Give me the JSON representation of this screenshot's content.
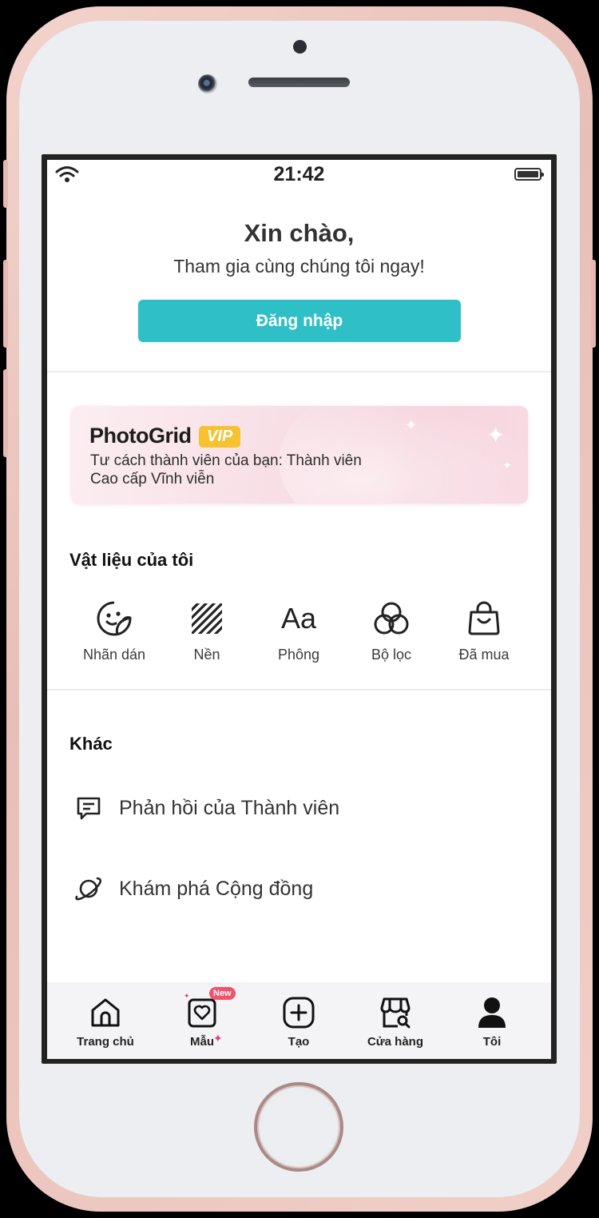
{
  "status_bar": {
    "time": "21:42"
  },
  "greeting": {
    "title": "Xin chào,",
    "subtitle": "Tham gia cùng chúng tôi ngay!",
    "login_label": "Đăng nhập"
  },
  "vip": {
    "brand": "PhotoGrid",
    "badge": "VIP",
    "line1": "Tư cách thành viên của bạn: Thành viên",
    "line2": "Cao cấp Vĩnh viễn"
  },
  "materials": {
    "title": "Vật liệu của tôi",
    "items": [
      {
        "label": "Nhãn dán",
        "icon": "sticker-icon"
      },
      {
        "label": "Nền",
        "icon": "background-pattern-icon"
      },
      {
        "label": "Phông",
        "icon": "font-icon"
      },
      {
        "label": "Bộ lọc",
        "icon": "filter-icon"
      },
      {
        "label": "Đã mua",
        "icon": "shopping-bag-icon"
      }
    ]
  },
  "other": {
    "title": "Khác",
    "items": [
      {
        "label": "Phản hồi của Thành viên",
        "icon": "feedback-icon"
      },
      {
        "label": "Khám phá Cộng đồng",
        "icon": "planet-icon"
      }
    ]
  },
  "font_icon_text": "Aa",
  "tabbar": {
    "items": [
      {
        "label": "Trang chủ",
        "icon": "home-icon"
      },
      {
        "label": "Mẫu",
        "icon": "template-heart-icon",
        "badge": "New"
      },
      {
        "label": "Tạo",
        "icon": "create-plus-icon"
      },
      {
        "label": "Cửa hàng",
        "icon": "store-icon"
      },
      {
        "label": "Tôi",
        "icon": "profile-icon",
        "active": true
      }
    ]
  },
  "colors": {
    "accent": "#2fbfc6",
    "vip_badge": "#f6c232",
    "new_badge": "#f0516b"
  }
}
